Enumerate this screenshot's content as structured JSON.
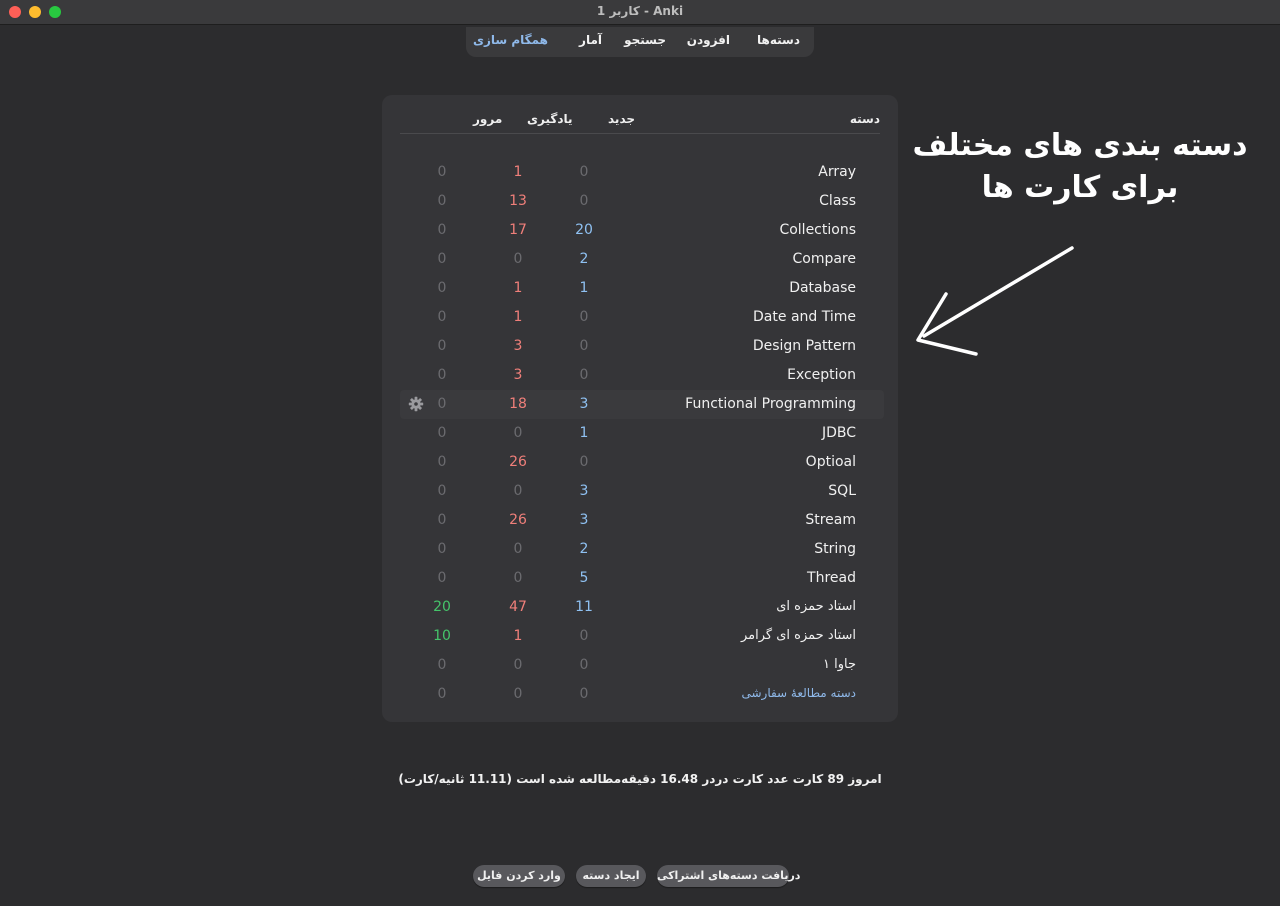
{
  "window": {
    "title": "کاربر 1 - Anki"
  },
  "toolbar": {
    "decks": "دسته‌ها",
    "add": "افزودن",
    "browse": "جستجو",
    "stats": "آمار",
    "sync": "همگام سازی"
  },
  "table_headers": {
    "deck": "دسته",
    "new": "جدید",
    "learn": "یادگیری",
    "due": "مرور"
  },
  "decks": [
    {
      "name": "Array",
      "new": "0",
      "learn": "1",
      "due": "0"
    },
    {
      "name": "Class",
      "new": "0",
      "learn": "13",
      "due": "0"
    },
    {
      "name": "Collections",
      "new": "20",
      "learn": "17",
      "due": "0"
    },
    {
      "name": "Compare",
      "new": "2",
      "learn": "0",
      "due": "0"
    },
    {
      "name": "Database",
      "new": "1",
      "learn": "1",
      "due": "0"
    },
    {
      "name": "Date and Time",
      "new": "0",
      "learn": "1",
      "due": "0"
    },
    {
      "name": "Design Pattern",
      "new": "0",
      "learn": "3",
      "due": "0"
    },
    {
      "name": "Exception",
      "new": "0",
      "learn": "3",
      "due": "0"
    },
    {
      "name": "Functional Programming",
      "new": "3",
      "learn": "18",
      "due": "0"
    },
    {
      "name": "JDBC",
      "new": "1",
      "learn": "0",
      "due": "0"
    },
    {
      "name": "Optioal",
      "new": "0",
      "learn": "26",
      "due": "0"
    },
    {
      "name": "SQL",
      "new": "3",
      "learn": "0",
      "due": "0"
    },
    {
      "name": "Stream",
      "new": "3",
      "learn": "26",
      "due": "0"
    },
    {
      "name": "String",
      "new": "2",
      "learn": "0",
      "due": "0"
    },
    {
      "name": "Thread",
      "new": "5",
      "learn": "0",
      "due": "0"
    },
    {
      "name": "استاد حمزه ای",
      "new": "11",
      "learn": "47",
      "due": "20"
    },
    {
      "name": "استاد حمزه ای گرامر",
      "new": "0",
      "learn": "1",
      "due": "10"
    },
    {
      "name": "جاوا ۱",
      "new": "0",
      "learn": "0",
      "due": "0"
    },
    {
      "name": "دسته مطالعهٔ سفارشی",
      "new": "0",
      "learn": "0",
      "due": "0"
    }
  ],
  "annotation": {
    "line1": "دسته بندی های مختلف",
    "line2": "برای کارت ها"
  },
  "stats_line": "امروز 89 کارت عدد کارت دردر 16.48 دقیقه‌مطالعه شده است (11.11 ثانیه/کارت)",
  "buttons": {
    "shared": "دریافت دسته‌های اشتراکی",
    "create": "ایجاد دسته",
    "import": "وارد کردن فایل"
  },
  "colors": {
    "new": "#8fc1f2",
    "learn": "#f07f7a",
    "due": "#45c46a",
    "zero": "#6b6b6f",
    "accent": "#8fb9ea"
  }
}
